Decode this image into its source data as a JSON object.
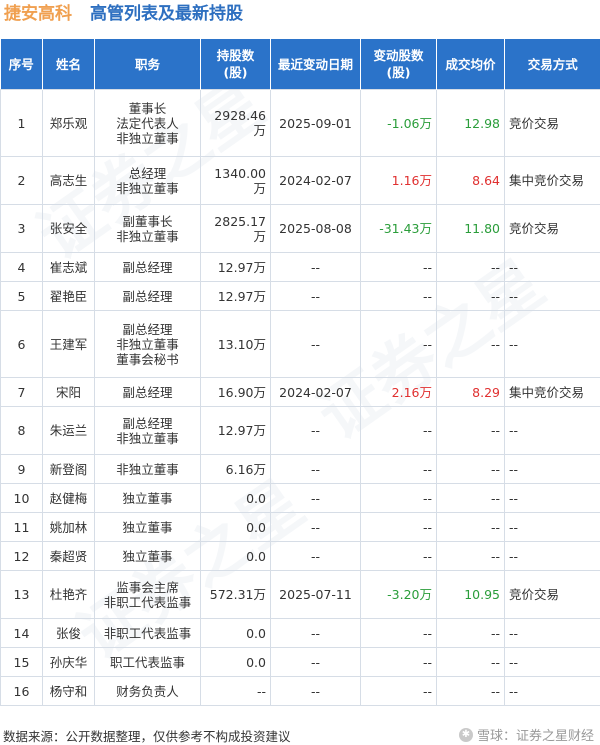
{
  "header": {
    "company": "捷安高科",
    "title": "高管列表及最新持股"
  },
  "columns": [
    "序号",
    "姓名",
    "职务",
    "持股数\n(股)",
    "最近变动日期",
    "变动股数\n(股)",
    "成交均价",
    "交易方式"
  ],
  "rows": [
    {
      "no": "1",
      "name": "郑乐观",
      "roles": [
        "董事长",
        "法定代表人",
        "非独立董事"
      ],
      "shares": "2928.46万",
      "date": "2025-09-01",
      "change": "-1.06万",
      "price": "12.98",
      "method": "竞价交易",
      "sign": "neg"
    },
    {
      "no": "2",
      "name": "高志生",
      "roles": [
        "总经理",
        "非独立董事"
      ],
      "shares": "1340.00万",
      "date": "2024-02-07",
      "change": "1.16万",
      "price": "8.64",
      "method": "集中竞价交易",
      "sign": "pos"
    },
    {
      "no": "3",
      "name": "张安全",
      "roles": [
        "副董事长",
        "非独立董事"
      ],
      "shares": "2825.17万",
      "date": "2025-08-08",
      "change": "-31.43万",
      "price": "11.80",
      "method": "竞价交易",
      "sign": "neg"
    },
    {
      "no": "4",
      "name": "崔志斌",
      "roles": [
        "副总经理"
      ],
      "shares": "12.97万",
      "date": "--",
      "change": "--",
      "price": "--",
      "method": "--",
      "sign": ""
    },
    {
      "no": "5",
      "name": "翟艳臣",
      "roles": [
        "副总经理"
      ],
      "shares": "12.97万",
      "date": "--",
      "change": "--",
      "price": "--",
      "method": "--",
      "sign": ""
    },
    {
      "no": "6",
      "name": "王建军",
      "roles": [
        "副总经理",
        "非独立董事",
        "董事会秘书"
      ],
      "shares": "13.10万",
      "date": "--",
      "change": "--",
      "price": "--",
      "method": "--",
      "sign": ""
    },
    {
      "no": "7",
      "name": "宋阳",
      "roles": [
        "副总经理"
      ],
      "shares": "16.90万",
      "date": "2024-02-07",
      "change": "2.16万",
      "price": "8.29",
      "method": "集中竞价交易",
      "sign": "pos"
    },
    {
      "no": "8",
      "name": "朱运兰",
      "roles": [
        "副总经理",
        "非独立董事"
      ],
      "shares": "12.97万",
      "date": "--",
      "change": "--",
      "price": "--",
      "method": "--",
      "sign": ""
    },
    {
      "no": "9",
      "name": "新登阁",
      "roles": [
        "非独立董事"
      ],
      "shares": "6.16万",
      "date": "--",
      "change": "--",
      "price": "--",
      "method": "--",
      "sign": ""
    },
    {
      "no": "10",
      "name": "赵健梅",
      "roles": [
        "独立董事"
      ],
      "shares": "0.0",
      "date": "--",
      "change": "--",
      "price": "--",
      "method": "--",
      "sign": ""
    },
    {
      "no": "11",
      "name": "姚加林",
      "roles": [
        "独立董事"
      ],
      "shares": "0.0",
      "date": "--",
      "change": "--",
      "price": "--",
      "method": "--",
      "sign": ""
    },
    {
      "no": "12",
      "name": "秦超贤",
      "roles": [
        "独立董事"
      ],
      "shares": "0.0",
      "date": "--",
      "change": "--",
      "price": "--",
      "method": "--",
      "sign": ""
    },
    {
      "no": "13",
      "name": "杜艳齐",
      "roles": [
        "监事会主席",
        "非职工代表监事"
      ],
      "shares": "572.31万",
      "date": "2025-07-11",
      "change": "-3.20万",
      "price": "10.95",
      "method": "竞价交易",
      "sign": "neg"
    },
    {
      "no": "14",
      "name": "张俊",
      "roles": [
        "非职工代表监事"
      ],
      "shares": "0.0",
      "date": "--",
      "change": "--",
      "price": "--",
      "method": "--",
      "sign": ""
    },
    {
      "no": "15",
      "name": "孙庆华",
      "roles": [
        "职工代表监事"
      ],
      "shares": "0.0",
      "date": "--",
      "change": "--",
      "price": "--",
      "method": "--",
      "sign": ""
    },
    {
      "no": "16",
      "name": "杨守和",
      "roles": [
        "财务负责人"
      ],
      "shares": "--",
      "date": "--",
      "change": "--",
      "price": "--",
      "method": "--",
      "sign": ""
    }
  ],
  "footer": {
    "note": "数据来源：公开数据整理，仅供参考不构成投资建议",
    "brand": "雪球：证券之星财经"
  },
  "watermark": "证券之星",
  "colors": {
    "header_bg": "#2b73c9",
    "company": "#f0a050",
    "title": "#2d6fc0",
    "negative": "#2a9d3a",
    "positive": "#e03030"
  }
}
